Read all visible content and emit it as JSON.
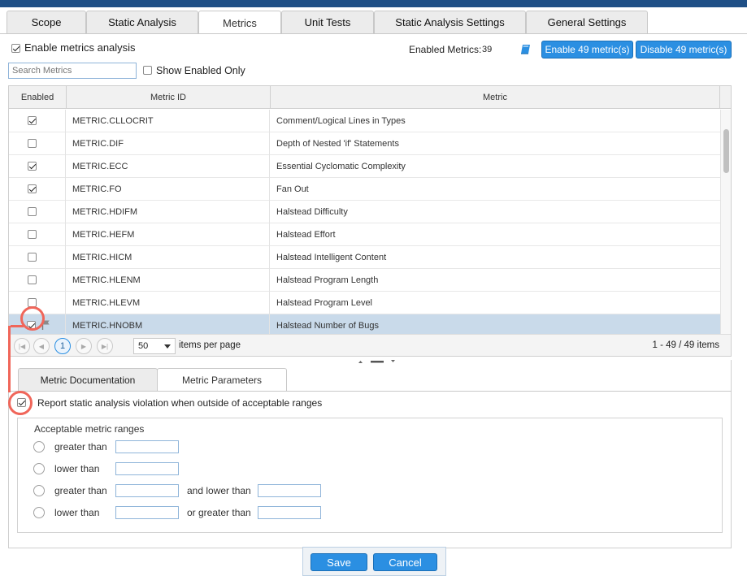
{
  "tabs": [
    "Scope",
    "Static Analysis",
    "Metrics",
    "Unit Tests",
    "Static Analysis Settings",
    "General Settings"
  ],
  "active_tab": "Metrics",
  "enable_metrics": {
    "label": "Enable metrics analysis",
    "checked": true
  },
  "enabled_metrics": {
    "label": "Enabled Metrics:",
    "count": "39"
  },
  "buttons": {
    "enable_all": "Enable 49 metric(s)",
    "disable_all": "Disable 49 metric(s)"
  },
  "search": {
    "placeholder": "Search Metrics",
    "value": ""
  },
  "show_enabled_only": {
    "label": "Show Enabled Only",
    "checked": false
  },
  "table": {
    "columns": [
      "Enabled",
      "Metric ID",
      "Metric"
    ],
    "rows": [
      {
        "enabled": true,
        "id": "METRIC.CLLOCRIT",
        "name": "Comment/Logical Lines in Types"
      },
      {
        "enabled": false,
        "id": "METRIC.DIF",
        "name": "Depth of Nested 'if' Statements"
      },
      {
        "enabled": true,
        "id": "METRIC.ECC",
        "name": "Essential Cyclomatic Complexity"
      },
      {
        "enabled": true,
        "id": "METRIC.FO",
        "name": "Fan Out"
      },
      {
        "enabled": false,
        "id": "METRIC.HDIFM",
        "name": "Halstead Difficulty"
      },
      {
        "enabled": false,
        "id": "METRIC.HEFM",
        "name": "Halstead Effort"
      },
      {
        "enabled": false,
        "id": "METRIC.HICM",
        "name": "Halstead Intelligent Content"
      },
      {
        "enabled": false,
        "id": "METRIC.HLENM",
        "name": "Halstead Program Length"
      },
      {
        "enabled": false,
        "id": "METRIC.HLEVM",
        "name": "Halstead Program Level"
      },
      {
        "enabled": true,
        "id": "METRIC.HNOBM",
        "name": "Halstead Number of Bugs",
        "selected": true,
        "flagged": true
      }
    ]
  },
  "pager": {
    "current_page": "1",
    "page_size": "50",
    "page_size_label": "items per page",
    "summary": "1 - 49 / 49 items"
  },
  "bottom_tabs": [
    "Metric Documentation",
    "Metric Parameters"
  ],
  "active_bottom_tab": "Metric Parameters",
  "report_violation": {
    "label": "Report static analysis violation when outside of acceptable ranges",
    "checked": true
  },
  "ranges": {
    "title": "Acceptable metric ranges",
    "options": [
      {
        "label": "greater than"
      },
      {
        "label": "lower than"
      },
      {
        "label": "greater than",
        "second_label": "and lower than"
      },
      {
        "label": "lower than",
        "second_label": "or greater than"
      }
    ]
  },
  "footer": {
    "save": "Save",
    "cancel": "Cancel"
  },
  "colors": {
    "accent": "#2b8fe2",
    "annotation": "#f0665a",
    "selected_row": "#c9daea",
    "topbar": "#1f4f86"
  }
}
